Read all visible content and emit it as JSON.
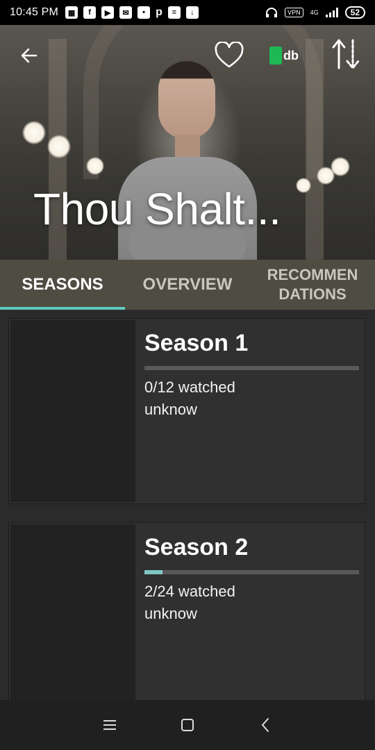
{
  "status_bar": {
    "time": "10:45 PM",
    "icons": [
      "calendar-icon",
      "facebook-icon",
      "youtube-icon",
      "mail-icon",
      "chat-icon",
      "p-app-icon",
      "app-icon",
      "download-icon"
    ],
    "icon_glyphs": {
      "facebook": "f",
      "p": "p"
    },
    "vpn": "VPN",
    "network": "4G",
    "battery": "52"
  },
  "header": {
    "title": "Thou Shalt...",
    "tmdb_label": "db"
  },
  "tabs": [
    {
      "label": "SEASONS",
      "active": true
    },
    {
      "label": "OVERVIEW",
      "active": false
    },
    {
      "label": "RECOMMEN DATIONS",
      "line1": "RECOMMEN",
      "line2": "DATIONS",
      "active": false
    }
  ],
  "seasons": [
    {
      "title": "Season 1",
      "watched": "0/12 watched",
      "date": "unknow",
      "progress": 0.0
    },
    {
      "title": "Season 2",
      "watched": "2/24 watched",
      "date": "unknow",
      "progress": 0.083
    }
  ],
  "colors": {
    "accent": "#5fc9bf",
    "tab_bg": "#4f4c41",
    "card_bg": "#303030",
    "progress_track": "#595959",
    "tmdb_green": "#1db954"
  }
}
